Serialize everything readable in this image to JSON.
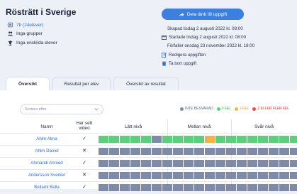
{
  "header": {
    "title": "Rösträtt i Sverige",
    "class_label": "7b (24elever)",
    "groups_label": "Inga grupper",
    "students_label": "Inga enskilda elever",
    "share_button": "Dela länk till uppgift",
    "created": "Skapad tisdag 2 augusti 2022 kl. 08:00",
    "started": "Startade tisdag 2 augusti 2022 kl. 08:00",
    "due": "Förfaller onsdag 23 november 2022 kl. 18:00",
    "edit_link": "Redigera uppgiften",
    "delete_link": "Ta bort uppgift"
  },
  "tabs": [
    {
      "label": "Översikt"
    },
    {
      "label": "Resultat per elev"
    },
    {
      "label": "Översikt av resultat"
    }
  ],
  "sort": {
    "placeholder": "Sortera efter"
  },
  "legend": [
    {
      "label": "INTE BESVARAD",
      "color": "#7f8aa8"
    },
    {
      "label": "0 FEL",
      "color": "#5ccf7a"
    },
    {
      "label": "1 FEL",
      "color": "#f4b04a"
    },
    {
      "label": "2 ELLER FLER FEL",
      "color": "#e04b4b"
    }
  ],
  "table": {
    "col_name": "Namn",
    "col_video": "Har sett video",
    "col_easy": "Lätt nivå",
    "col_mid": "Mellan nivå",
    "col_hard": "Svår nivå",
    "rows": [
      {
        "name": "Ahlm Alma",
        "video": "✓",
        "cells": [
          "g",
          "g",
          "g",
          "g",
          "g",
          "n",
          "g",
          "g",
          "g",
          "g",
          "o",
          "g",
          "g",
          "g",
          "g",
          "g",
          "g",
          "g",
          "g"
        ]
      },
      {
        "name": "Ahlm Daniel",
        "video": "✕",
        "cells": [
          "n",
          "n",
          "n",
          "n",
          "n",
          "n",
          "n",
          "n",
          "n",
          "n",
          "n",
          "n",
          "n",
          "n",
          "n",
          "n",
          "n",
          "n",
          "n"
        ]
      },
      {
        "name": "Ahmandi Ahmed",
        "video": "✓",
        "cells": [
          "n",
          "n",
          "n",
          "n",
          "n",
          "n",
          "n",
          "n",
          "n",
          "n",
          "n",
          "n",
          "n",
          "n",
          "n",
          "n",
          "n",
          "n",
          "n"
        ]
      },
      {
        "name": "Andersson Sverker",
        "video": "✕",
        "cells": [
          "n",
          "n",
          "n",
          "n",
          "n",
          "n",
          "n",
          "n",
          "n",
          "n",
          "n",
          "n",
          "n",
          "n",
          "n",
          "n",
          "n",
          "n",
          "n"
        ]
      },
      {
        "name": "Bellami Bella",
        "video": "✓",
        "cells": [
          "n",
          "n",
          "n",
          "n",
          "n",
          "n",
          "n",
          "n",
          "n",
          "n",
          "n",
          "n",
          "n",
          "n",
          "n",
          "n",
          "n",
          "n",
          "n"
        ]
      }
    ]
  },
  "colors": {
    "accent": "#3c7fe0",
    "g": "#5ccf7a",
    "n": "#7f8aa8",
    "o": "#f4b04a",
    "r": "#e04b4b"
  }
}
